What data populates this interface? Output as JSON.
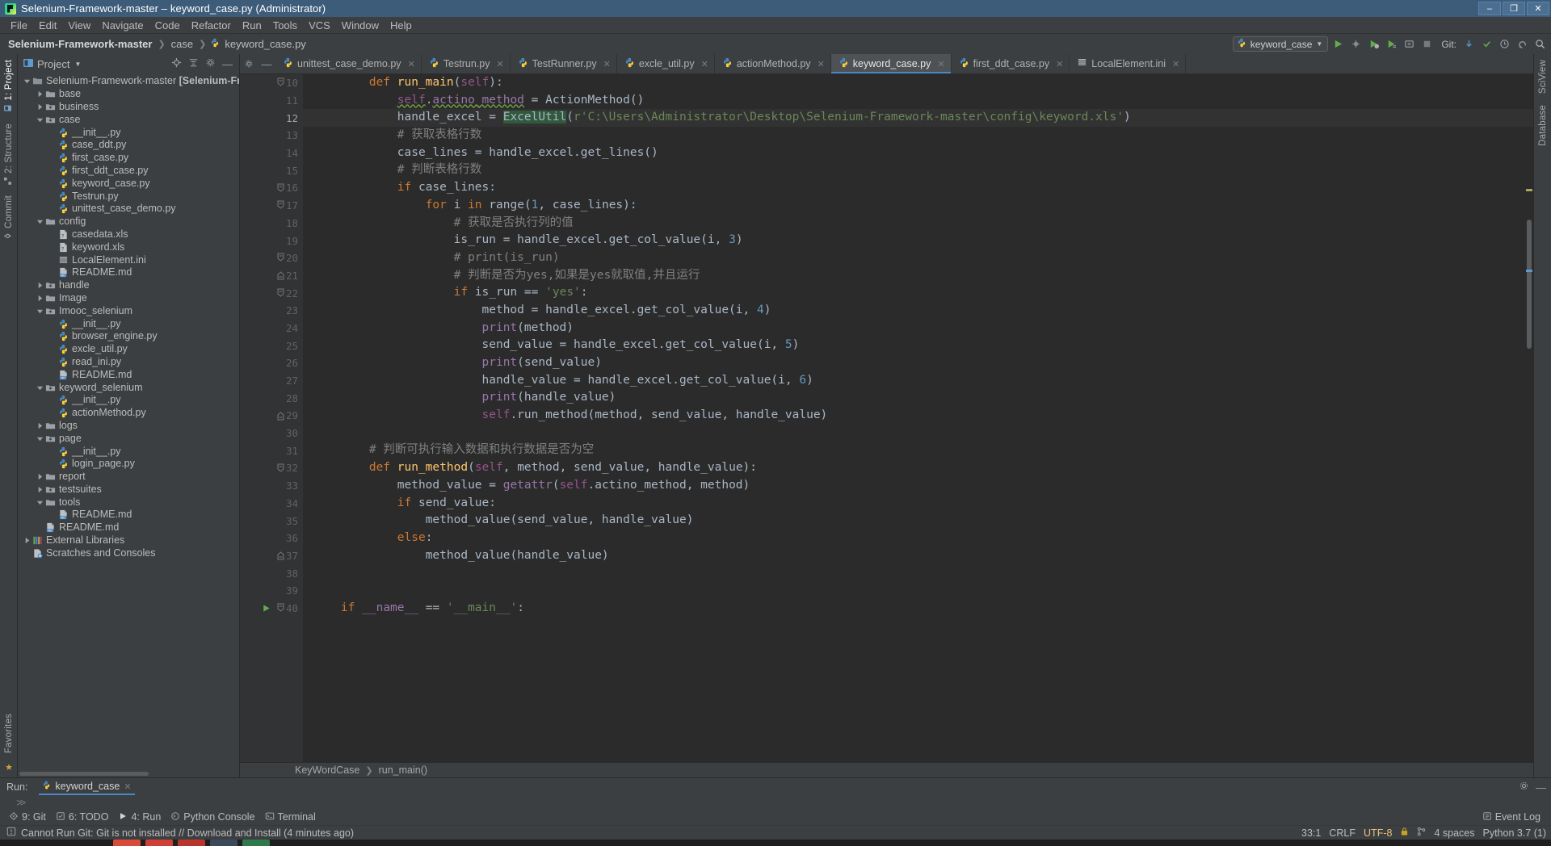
{
  "window": {
    "title": "Selenium-Framework-master – keyword_case.py (Administrator)",
    "minimize": "–",
    "maximize": "❐",
    "close": "✕"
  },
  "menubar": [
    "File",
    "Edit",
    "View",
    "Navigate",
    "Code",
    "Refactor",
    "Run",
    "Tools",
    "VCS",
    "Window",
    "Help"
  ],
  "breadcrumb": {
    "project": "Selenium-Framework-master",
    "folder": "case",
    "file": "keyword_case.py"
  },
  "toolbar": {
    "run_config": "keyword_case",
    "git_label": "Git:",
    "run_icon": "run-icon",
    "debug_icon": "debug-icon",
    "coverage_icon": "coverage-icon",
    "profile_icon": "profile-icon",
    "attach_icon": "attach-icon",
    "stop_icon": "stop-icon",
    "update_icon": "git-update-icon",
    "commit_icon": "git-commit-icon",
    "history_icon": "git-history-icon",
    "revert_icon": "git-revert-icon",
    "search_icon": "search-everywhere-icon"
  },
  "left_strip": {
    "tabs": [
      "1: Project",
      "2: Structure",
      "Commit"
    ],
    "bottom_tabs": [
      "Favorites"
    ]
  },
  "right_strip": {
    "tabs": [
      "SciView",
      "Database"
    ]
  },
  "project_panel": {
    "title": "Project",
    "locate_icon": "locate-icon",
    "collapse_icon": "collapse-all-icon",
    "settings_icon": "gear-icon",
    "hide_icon": "hide-icon",
    "tree": [
      {
        "depth": 0,
        "arrow": "open",
        "icon": "project-folder",
        "label": "Selenium-Framework-master",
        "suffix": " [Selenium-Framework"
      },
      {
        "depth": 1,
        "arrow": "closed",
        "icon": "folder",
        "label": "base"
      },
      {
        "depth": 1,
        "arrow": "closed",
        "icon": "package",
        "label": "business"
      },
      {
        "depth": 1,
        "arrow": "open",
        "icon": "package",
        "label": "case"
      },
      {
        "depth": 2,
        "arrow": "none",
        "icon": "python",
        "label": "__init__.py"
      },
      {
        "depth": 2,
        "arrow": "none",
        "icon": "python",
        "label": "case_ddt.py"
      },
      {
        "depth": 2,
        "arrow": "none",
        "icon": "python",
        "label": "first_case.py"
      },
      {
        "depth": 2,
        "arrow": "none",
        "icon": "python",
        "label": "first_ddt_case.py"
      },
      {
        "depth": 2,
        "arrow": "none",
        "icon": "python",
        "label": "keyword_case.py"
      },
      {
        "depth": 2,
        "arrow": "none",
        "icon": "python",
        "label": "Testrun.py"
      },
      {
        "depth": 2,
        "arrow": "none",
        "icon": "python",
        "label": "unittest_case_demo.py"
      },
      {
        "depth": 1,
        "arrow": "open",
        "icon": "folder",
        "label": "config"
      },
      {
        "depth": 2,
        "arrow": "none",
        "icon": "xls",
        "label": "casedata.xls"
      },
      {
        "depth": 2,
        "arrow": "none",
        "icon": "xls",
        "label": "keyword.xls"
      },
      {
        "depth": 2,
        "arrow": "none",
        "icon": "ini",
        "label": "LocalElement.ini"
      },
      {
        "depth": 2,
        "arrow": "none",
        "icon": "md",
        "label": "README.md"
      },
      {
        "depth": 1,
        "arrow": "closed",
        "icon": "package",
        "label": "handle"
      },
      {
        "depth": 1,
        "arrow": "closed",
        "icon": "folder",
        "label": "Image"
      },
      {
        "depth": 1,
        "arrow": "open",
        "icon": "package",
        "label": "Imooc_selenium"
      },
      {
        "depth": 2,
        "arrow": "none",
        "icon": "python",
        "label": "__init__.py"
      },
      {
        "depth": 2,
        "arrow": "none",
        "icon": "python",
        "label": "browser_engine.py"
      },
      {
        "depth": 2,
        "arrow": "none",
        "icon": "python",
        "label": "excle_util.py"
      },
      {
        "depth": 2,
        "arrow": "none",
        "icon": "python",
        "label": "read_ini.py"
      },
      {
        "depth": 2,
        "arrow": "none",
        "icon": "md",
        "label": "README.md"
      },
      {
        "depth": 1,
        "arrow": "open",
        "icon": "package",
        "label": "keyword_selenium"
      },
      {
        "depth": 2,
        "arrow": "none",
        "icon": "python",
        "label": "__init__.py"
      },
      {
        "depth": 2,
        "arrow": "none",
        "icon": "python",
        "label": "actionMethod.py"
      },
      {
        "depth": 1,
        "arrow": "closed",
        "icon": "folder",
        "label": "logs"
      },
      {
        "depth": 1,
        "arrow": "open",
        "icon": "package",
        "label": "page"
      },
      {
        "depth": 2,
        "arrow": "none",
        "icon": "python",
        "label": "__init__.py"
      },
      {
        "depth": 2,
        "arrow": "none",
        "icon": "python",
        "label": "login_page.py"
      },
      {
        "depth": 1,
        "arrow": "closed",
        "icon": "folder",
        "label": "report"
      },
      {
        "depth": 1,
        "arrow": "closed",
        "icon": "package",
        "label": "testsuites"
      },
      {
        "depth": 1,
        "arrow": "open",
        "icon": "folder",
        "label": "tools"
      },
      {
        "depth": 2,
        "arrow": "none",
        "icon": "md",
        "label": "README.md"
      },
      {
        "depth": 1,
        "arrow": "none",
        "icon": "md",
        "label": "README.md"
      },
      {
        "depth": 0,
        "arrow": "closed",
        "icon": "library",
        "label": "External Libraries"
      },
      {
        "depth": 0,
        "arrow": "none",
        "icon": "scratch",
        "label": "Scratches and Consoles"
      }
    ]
  },
  "editor_tabs": [
    {
      "label": "unittest_case_demo.py",
      "icon": "python",
      "active": false
    },
    {
      "label": "Testrun.py",
      "icon": "python",
      "active": false
    },
    {
      "label": "TestRunner.py",
      "icon": "python",
      "active": false
    },
    {
      "label": "excle_util.py",
      "icon": "python",
      "active": false
    },
    {
      "label": "actionMethod.py",
      "icon": "python",
      "active": false
    },
    {
      "label": "keyword_case.py",
      "icon": "python",
      "active": true
    },
    {
      "label": "first_ddt_case.py",
      "icon": "python",
      "active": false
    },
    {
      "label": "LocalElement.ini",
      "icon": "ini",
      "active": false
    }
  ],
  "code": {
    "first_line": 10,
    "current_line": 12,
    "lines": [
      {
        "n": 10,
        "fold": "open",
        "indent": 2,
        "tokens": [
          {
            "t": "def ",
            "c": "k"
          },
          {
            "t": "run_main",
            "c": "f"
          },
          {
            "t": "(",
            "c": "t"
          },
          {
            "t": "self",
            "c": "self"
          },
          {
            "t": "):",
            "c": "t"
          }
        ]
      },
      {
        "n": 11,
        "fold": "",
        "indent": 3,
        "tokens": [
          {
            "t": "self",
            "c": "self err"
          },
          {
            "t": ".",
            "c": "t"
          },
          {
            "t": "actino_method",
            "c": "d err"
          },
          {
            "t": " = ",
            "c": "t"
          },
          {
            "t": "ActionMethod()",
            "c": "t"
          }
        ]
      },
      {
        "n": 12,
        "fold": "",
        "indent": 3,
        "tokens": [
          {
            "t": "handle_excel = ",
            "c": "t"
          },
          {
            "t": "ExcelUtil",
            "c": "t hl"
          },
          {
            "t": "(",
            "c": "t"
          },
          {
            "t": "r'C:\\Users\\Administrator\\Desktop\\Selenium-Framework-master\\config\\keyword.xls'",
            "c": "s"
          },
          {
            "t": ")",
            "c": "t"
          }
        ]
      },
      {
        "n": 13,
        "fold": "",
        "indent": 3,
        "tokens": [
          {
            "t": "# 获取表格行数",
            "c": "c"
          }
        ]
      },
      {
        "n": 14,
        "fold": "",
        "indent": 3,
        "tokens": [
          {
            "t": "case_lines = handle_excel.get_lines()",
            "c": "t"
          }
        ]
      },
      {
        "n": 15,
        "fold": "",
        "indent": 3,
        "tokens": [
          {
            "t": "# 判断表格行数",
            "c": "c"
          }
        ]
      },
      {
        "n": 16,
        "fold": "open",
        "indent": 3,
        "tokens": [
          {
            "t": "if ",
            "c": "k"
          },
          {
            "t": "case_lines:",
            "c": "t"
          }
        ]
      },
      {
        "n": 17,
        "fold": "open",
        "indent": 4,
        "tokens": [
          {
            "t": "for ",
            "c": "k"
          },
          {
            "t": "i ",
            "c": "t"
          },
          {
            "t": "in ",
            "c": "k"
          },
          {
            "t": "range(",
            "c": "t"
          },
          {
            "t": "1",
            "c": "n"
          },
          {
            "t": ", case_lines):",
            "c": "t"
          }
        ]
      },
      {
        "n": 18,
        "fold": "",
        "indent": 5,
        "tokens": [
          {
            "t": "# 获取是否执行列的值",
            "c": "c"
          }
        ]
      },
      {
        "n": 19,
        "fold": "",
        "indent": 5,
        "tokens": [
          {
            "t": "is_run = handle_excel.get_col_value(i, ",
            "c": "t"
          },
          {
            "t": "3",
            "c": "n"
          },
          {
            "t": ")",
            "c": "t"
          }
        ]
      },
      {
        "n": 20,
        "fold": "open",
        "indent": 5,
        "tokens": [
          {
            "t": "# print(is_run)",
            "c": "c"
          }
        ]
      },
      {
        "n": 21,
        "fold": "close",
        "indent": 5,
        "tokens": [
          {
            "t": "# 判断是否为yes,如果是yes就取值,并且运行",
            "c": "c"
          }
        ]
      },
      {
        "n": 22,
        "fold": "open",
        "indent": 5,
        "tokens": [
          {
            "t": "if ",
            "c": "k"
          },
          {
            "t": "is_run == ",
            "c": "t"
          },
          {
            "t": "'yes'",
            "c": "s"
          },
          {
            "t": ":",
            "c": "t"
          }
        ]
      },
      {
        "n": 23,
        "fold": "",
        "indent": 6,
        "tokens": [
          {
            "t": "method = handle_excel.get_col_value(i, ",
            "c": "t"
          },
          {
            "t": "4",
            "c": "n"
          },
          {
            "t": ")",
            "c": "t"
          }
        ]
      },
      {
        "n": 24,
        "fold": "",
        "indent": 6,
        "tokens": [
          {
            "t": "print",
            "c": "d"
          },
          {
            "t": "(method)",
            "c": "t"
          }
        ]
      },
      {
        "n": 25,
        "fold": "",
        "indent": 6,
        "tokens": [
          {
            "t": "send_value = handle_excel.get_col_value(i, ",
            "c": "t"
          },
          {
            "t": "5",
            "c": "n"
          },
          {
            "t": ")",
            "c": "t"
          }
        ]
      },
      {
        "n": 26,
        "fold": "",
        "indent": 6,
        "tokens": [
          {
            "t": "print",
            "c": "d"
          },
          {
            "t": "(send_value)",
            "c": "t"
          }
        ]
      },
      {
        "n": 27,
        "fold": "",
        "indent": 6,
        "tokens": [
          {
            "t": "handle_value = handle_excel.get_col_value(i, ",
            "c": "t"
          },
          {
            "t": "6",
            "c": "n"
          },
          {
            "t": ")",
            "c": "t"
          }
        ]
      },
      {
        "n": 28,
        "fold": "",
        "indent": 6,
        "tokens": [
          {
            "t": "print",
            "c": "d"
          },
          {
            "t": "(handle_value)",
            "c": "t"
          }
        ]
      },
      {
        "n": 29,
        "fold": "close",
        "indent": 6,
        "tokens": [
          {
            "t": "self",
            "c": "self"
          },
          {
            "t": ".run_method(method, send_value, handle_value)",
            "c": "t"
          }
        ]
      },
      {
        "n": 30,
        "fold": "",
        "indent": 0,
        "tokens": []
      },
      {
        "n": 31,
        "fold": "",
        "indent": 2,
        "tokens": [
          {
            "t": "# 判断可执行输入数据和执行数据是否为空",
            "c": "c"
          }
        ]
      },
      {
        "n": 32,
        "fold": "open",
        "indent": 2,
        "tokens": [
          {
            "t": "def ",
            "c": "k"
          },
          {
            "t": "run_method",
            "c": "f"
          },
          {
            "t": "(",
            "c": "t"
          },
          {
            "t": "self",
            "c": "self"
          },
          {
            "t": ", method, send_value, handle_value):",
            "c": "t"
          }
        ]
      },
      {
        "n": 33,
        "fold": "",
        "indent": 3,
        "tokens": [
          {
            "t": "method_value = ",
            "c": "t"
          },
          {
            "t": "getattr",
            "c": "d"
          },
          {
            "t": "(",
            "c": "t"
          },
          {
            "t": "self",
            "c": "self"
          },
          {
            "t": ".actino_method, method)",
            "c": "t"
          }
        ]
      },
      {
        "n": 34,
        "fold": "",
        "indent": 3,
        "tokens": [
          {
            "t": "if ",
            "c": "k"
          },
          {
            "t": "send_value:",
            "c": "t"
          }
        ]
      },
      {
        "n": 35,
        "fold": "",
        "indent": 4,
        "tokens": [
          {
            "t": "method_value(send_value, handle_value)",
            "c": "t"
          }
        ]
      },
      {
        "n": 36,
        "fold": "",
        "indent": 3,
        "tokens": [
          {
            "t": "else",
            "c": "k"
          },
          {
            "t": ":",
            "c": "t"
          }
        ]
      },
      {
        "n": 37,
        "fold": "close",
        "indent": 4,
        "tokens": [
          {
            "t": "method_value(handle_value)",
            "c": "t"
          }
        ]
      },
      {
        "n": 38,
        "fold": "",
        "indent": 0,
        "tokens": []
      },
      {
        "n": 39,
        "fold": "",
        "indent": 0,
        "tokens": []
      },
      {
        "n": 40,
        "fold": "open",
        "indent": 1,
        "gutter_run": true,
        "tokens": [
          {
            "t": "if ",
            "c": "k"
          },
          {
            "t": "__name__",
            "c": "d"
          },
          {
            "t": " == ",
            "c": "t"
          },
          {
            "t": "'__main__'",
            "c": "s"
          },
          {
            "t": ":",
            "c": "t"
          }
        ]
      }
    ],
    "bottom_breadcrumb": [
      "KeyWordCase",
      "run_main()"
    ]
  },
  "run_window": {
    "label": "Run:",
    "tab": "keyword_case",
    "tab_icon": "python",
    "settings_icon": "gear-icon",
    "hide_icon": "hide-icon"
  },
  "status_bar": {
    "items": [
      {
        "label": "9: Git",
        "icon": "git-icon"
      },
      {
        "label": "6: TODO",
        "icon": "todo-icon"
      },
      {
        "label": "4: Run",
        "icon": "run-icon"
      },
      {
        "label": "Python Console",
        "icon": "python-console-icon"
      },
      {
        "label": "Terminal",
        "icon": "terminal-icon"
      }
    ],
    "event_log": "Event Log",
    "event_log_icon": "event-log-icon"
  },
  "status_bar2": {
    "message": "Cannot Run Git: Git is not installed // Download and Install (4 minutes ago)",
    "warning_icon": "warning-icon",
    "caret": "33:1",
    "line_sep": "CRLF",
    "encoding": "UTF-8",
    "indent": "4 spaces",
    "interpreter": "Python 3.7 (1)",
    "lock_icon": "lock-icon",
    "branch_icon": "branch-icon"
  },
  "colors": {
    "accent": "#4a88c7",
    "title_bg": "#3c5c7a",
    "panel_bg": "#3c3f41",
    "editor_bg": "#2b2b2b",
    "gutter_bg": "#313335",
    "keyword": "#cc7832",
    "string": "#6a8759",
    "number": "#6897bb",
    "comment": "#808080",
    "function": "#ffc66d",
    "self": "#94558d",
    "field": "#9876aa",
    "default_text": "#a9b7c6",
    "highlight": "#32593d"
  }
}
